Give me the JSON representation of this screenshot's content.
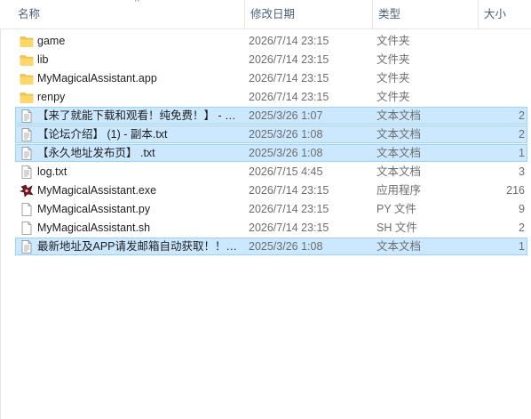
{
  "columns": {
    "name": "名称",
    "date": "修改日期",
    "type": "类型",
    "size": "大小",
    "sort_indicator": "^"
  },
  "files": [
    {
      "name": "game",
      "date": "2026/7/14 23:15",
      "type": "文件夹",
      "size": "",
      "icon": "folder-icon",
      "selected": false
    },
    {
      "name": "lib",
      "date": "2026/7/14 23:15",
      "type": "文件夹",
      "size": "",
      "icon": "folder-icon",
      "selected": false
    },
    {
      "name": "MyMagicalAssistant.app",
      "date": "2026/7/14 23:15",
      "type": "文件夹",
      "size": "",
      "icon": "folder-icon",
      "selected": false
    },
    {
      "name": "renpy",
      "date": "2026/7/14 23:15",
      "type": "文件夹",
      "size": "",
      "icon": "folder-icon",
      "selected": false
    },
    {
      "name": "【来了就能下载和观看！纯免费！】 - 副...",
      "date": "2025/3/26 1:07",
      "type": "文本文档",
      "size": "2",
      "icon": "text-document-icon",
      "selected": true
    },
    {
      "name": "【论坛介绍】 (1) - 副本.txt",
      "date": "2025/3/26 1:08",
      "type": "文本文档",
      "size": "2",
      "icon": "text-document-icon",
      "selected": true
    },
    {
      "name": "【永久地址发布页】 .txt",
      "date": "2025/3/26 1:08",
      "type": "文本文档",
      "size": "1",
      "icon": "text-document-icon",
      "selected": true
    },
    {
      "name": "log.txt",
      "date": "2026/7/15 4:45",
      "type": "文本文档",
      "size": "3",
      "icon": "text-document-icon",
      "selected": false
    },
    {
      "name": "MyMagicalAssistant.exe",
      "date": "2026/7/14 23:15",
      "type": "应用程序",
      "size": "216",
      "icon": "application-icon",
      "selected": false
    },
    {
      "name": "MyMagicalAssistant.py",
      "date": "2026/7/14 23:15",
      "type": "PY 文件",
      "size": "9",
      "icon": "file-icon",
      "selected": false
    },
    {
      "name": "MyMagicalAssistant.sh",
      "date": "2026/7/14 23:15",
      "type": "SH 文件",
      "size": "2",
      "icon": "file-icon",
      "selected": false
    },
    {
      "name": "最新地址及APP请发邮箱自动获取！！！...",
      "date": "2025/3/26 1:08",
      "type": "文本文档",
      "size": "1",
      "icon": "text-document-icon",
      "selected": true
    }
  ],
  "colors": {
    "folder": "#f5c451",
    "selection": "#cce8ff",
    "selection_border": "#99d1ff",
    "header_text": "#4c607a"
  }
}
